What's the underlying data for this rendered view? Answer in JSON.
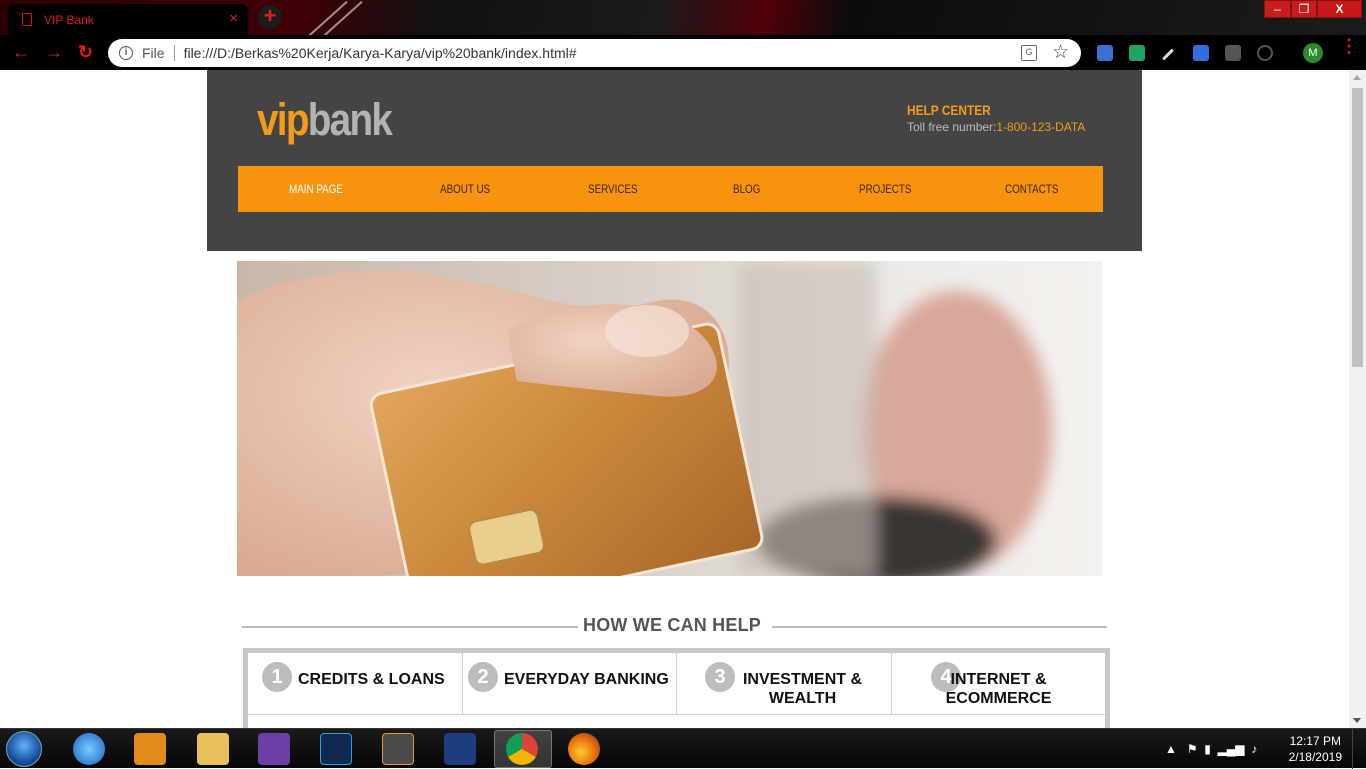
{
  "browser": {
    "tab_title": "VIP Bank",
    "tab_close": "×",
    "new_tab": "+",
    "window_min": "–",
    "window_max": "❐",
    "window_close": "X",
    "back": "←",
    "forward": "→",
    "reload": "↻",
    "info_icon": "i",
    "file_label": "File",
    "url": "file:///D:/Berkas%20Kerja/Karya-Karya/vip%20bank/index.html#",
    "star": "☆",
    "profile_initial": "M",
    "menu": "⋮"
  },
  "site": {
    "logo_vip": "vip",
    "logo_bank": "bank",
    "help_title": "HELP CENTER",
    "toll_label": "Toll free number:",
    "toll_number": "1-800-123-DATA",
    "nav": [
      "MAIN PAGE",
      "ABOUT US",
      "SERVICES",
      "BLOG",
      "PROJECTS",
      "CONTACTS"
    ],
    "active_nav": "MAIN PAGE",
    "section_heading": "HOW WE CAN HELP",
    "features": [
      {
        "num": "1",
        "title": "CREDITS & LOANS"
      },
      {
        "num": "2",
        "title": "EVERYDAY BANKING"
      },
      {
        "num": "3",
        "title": "INVESTMENT & WEALTH"
      },
      {
        "num": "4",
        "title": "INTERNET & ECOMMERCE"
      }
    ],
    "colors": {
      "accent": "#f7930f",
      "header_bg": "#444444",
      "logo_grey": "#b3b3b3"
    }
  },
  "taskbar": {
    "apps": [
      "internet-explorer",
      "media-player",
      "file-explorer",
      "visual-studio",
      "photoshop",
      "sublime-text",
      "devexpress",
      "chrome",
      "firefox"
    ],
    "time": "12:17 PM",
    "date": "2/18/2019"
  }
}
